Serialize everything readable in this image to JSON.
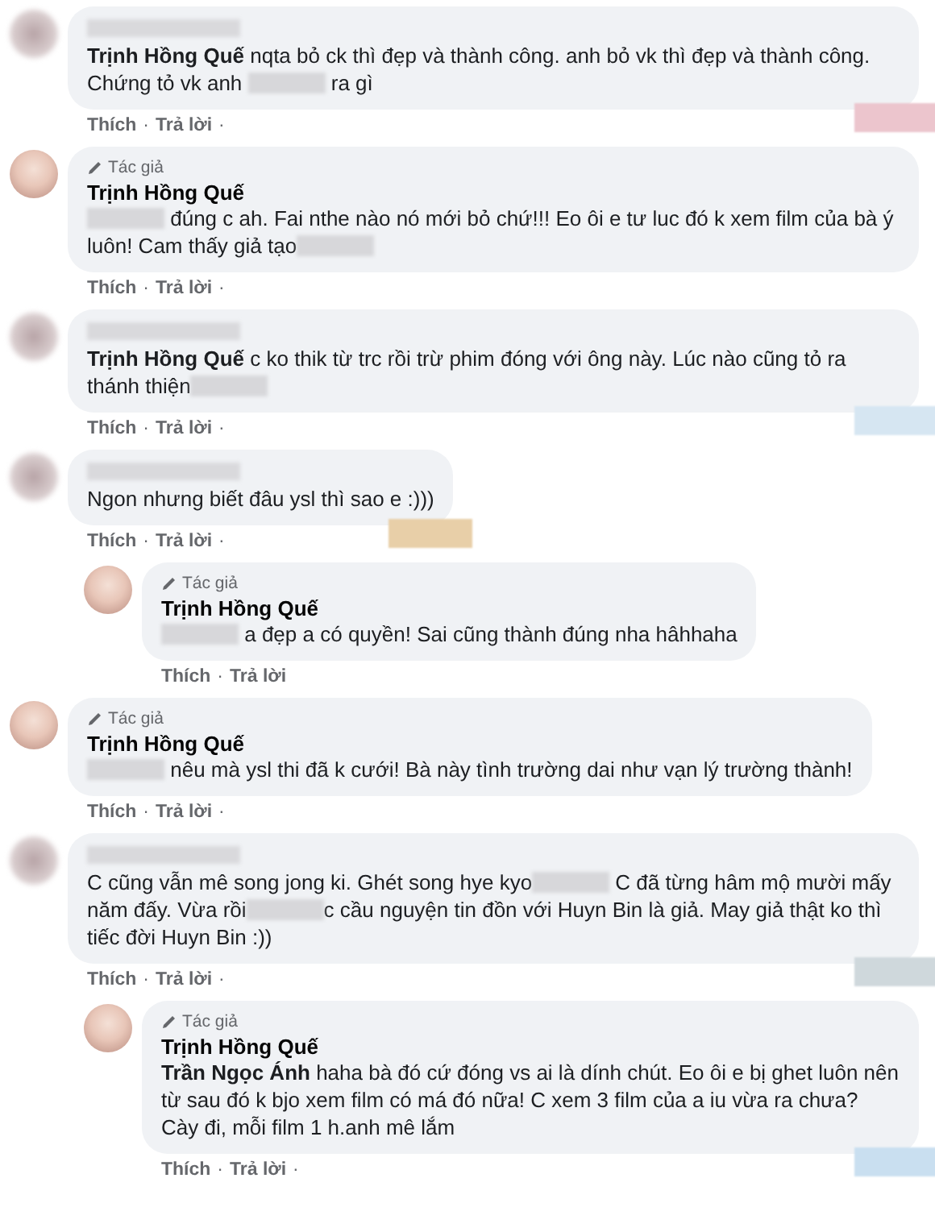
{
  "separator": "·",
  "comments": [
    {
      "author": {
        "kind": "redacted"
      },
      "body": [
        {
          "kind": "mention",
          "text": "Trịnh Hồng Quế"
        },
        {
          "kind": "text",
          "text": " nqta bỏ ck thì đẹp và thành công. anh bỏ vk thì đẹp và thành công. Chứng tỏ vk anh "
        },
        {
          "kind": "blur"
        },
        {
          "kind": "text",
          "text": " ra gì"
        }
      ],
      "actions": [
        "Thích",
        "Trả lời"
      ],
      "trailing_separator": true,
      "reaction": {
        "color": "#ecc5cd"
      }
    },
    {
      "author": {
        "kind": "author",
        "badge": "Tác giả",
        "name": "Trịnh Hồng Quế"
      },
      "body": [
        {
          "kind": "blur"
        },
        {
          "kind": "text",
          "text": " đúng c ah. Fai nthe nào nó mới bỏ chứ!!! Eo ôi e tư luc đó k xem film của bà ý luôn! Cam thấy giả tạo"
        },
        {
          "kind": "blur"
        }
      ],
      "actions": [
        "Thích",
        "Trả lời"
      ],
      "trailing_separator": true
    },
    {
      "author": {
        "kind": "redacted"
      },
      "body": [
        {
          "kind": "mention",
          "text": "Trịnh Hồng Quế"
        },
        {
          "kind": "text",
          "text": " c ko thik từ trc rồi trừ phim đóng với ông này. Lúc nào cũng tỏ ra thánh thiện"
        },
        {
          "kind": "blur"
        }
      ],
      "actions": [
        "Thích",
        "Trả lời"
      ],
      "trailing_separator": true,
      "reaction": {
        "color": "#d6e6f2"
      }
    },
    {
      "author": {
        "kind": "redacted"
      },
      "body": [
        {
          "kind": "text",
          "text": "Ngon nhưng biết đâu ysl thì sao e :)))"
        }
      ],
      "actions": [
        "Thích",
        "Trả lời"
      ],
      "trailing_separator": true,
      "reaction": {
        "color": "#e8cfa8"
      },
      "children": [
        {
          "author": {
            "kind": "author",
            "badge": "Tác giả",
            "name": "Trịnh Hồng Quế"
          },
          "body": [
            {
              "kind": "blur"
            },
            {
              "kind": "text",
              "text": " a đẹp a có quyền! Sai cũng thành đúng nha hâhhaha"
            }
          ],
          "actions": [
            "Thích",
            "Trả lời"
          ],
          "trailing_separator": false
        }
      ]
    },
    {
      "author": {
        "kind": "author",
        "badge": "Tác giả",
        "name": "Trịnh Hồng Quế"
      },
      "body": [
        {
          "kind": "blur"
        },
        {
          "kind": "text",
          "text": " nêu mà ysl thi đã k cưới! Bà này tình trường dai như vạn lý trường thành!"
        }
      ],
      "actions": [
        "Thích",
        "Trả lời"
      ],
      "trailing_separator": true
    },
    {
      "author": {
        "kind": "redacted"
      },
      "body": [
        {
          "kind": "text",
          "text": "C cũng vẫn mê song jong ki. Ghét song hye kyo"
        },
        {
          "kind": "blur"
        },
        {
          "kind": "text",
          "text": " C đã từng hâm mộ mười mấy năm đấy. Vừa rồi"
        },
        {
          "kind": "blur"
        },
        {
          "kind": "text",
          "text": "c cầu nguyện tin đồn với Huyn Bin là giả. May giả thật ko thì tiếc đời Huyn Bin :))"
        }
      ],
      "actions": [
        "Thích",
        "Trả lời"
      ],
      "trailing_separator": true,
      "reaction": {
        "color": "#cfd8dc"
      },
      "children": [
        {
          "author": {
            "kind": "author",
            "badge": "Tác giả",
            "name": "Trịnh Hồng Quế"
          },
          "body": [
            {
              "kind": "mention",
              "text": "Trần Ngọc Ánh"
            },
            {
              "kind": "text",
              "text": " haha bà đó cứ đóng vs ai là dính chút. Eo ôi e bị ghet luôn nên từ sau đó k bjo xem film có má đó nữa! C xem 3 film của a iu vừa ra chưa? Cày đi, mỗi film 1 h.anh mê lắm"
            }
          ],
          "actions": [
            "Thích",
            "Trả lời"
          ],
          "trailing_separator": true,
          "reaction": {
            "color": "#c9dff0"
          }
        }
      ]
    }
  ]
}
